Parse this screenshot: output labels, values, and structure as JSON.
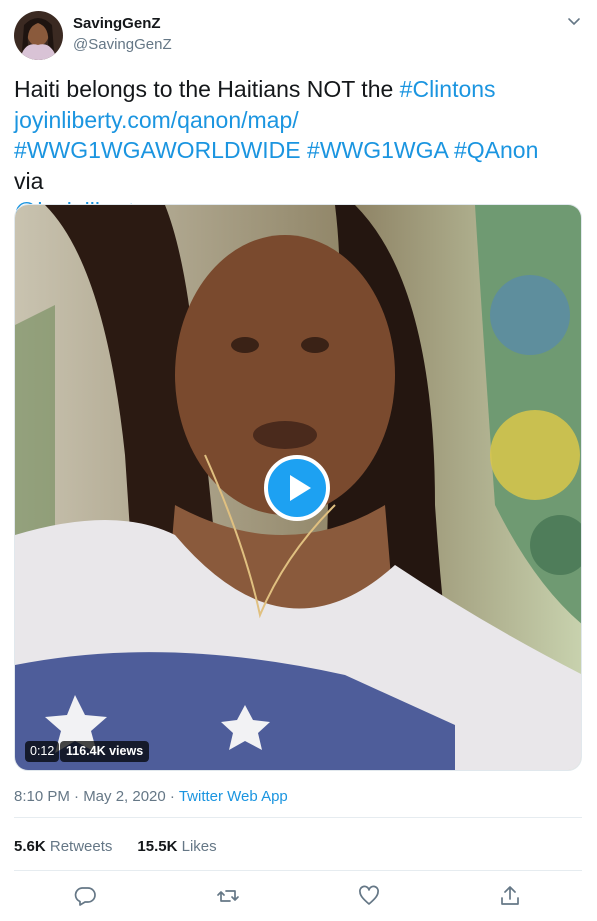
{
  "author": {
    "name": "SavingGenZ",
    "handle": "@SavingGenZ"
  },
  "tweet": {
    "text_plain_1": "Haiti belongs to the Haitians NOT the ",
    "hashtag_clintons": "#Clintons",
    "url": "joyinliberty.com/qanon/map/",
    "hashtag_1": "#WWG1WGAWORLDWIDE",
    "hashtag_2": "#WWG1WGA",
    "hashtag_3": "#QAnon",
    "via": " via",
    "mention": "@joyinliberty"
  },
  "video": {
    "duration": "0:12",
    "views": "116.4K views"
  },
  "meta": {
    "time": "8:10 PM · May 2, 2020 · ",
    "source": "Twitter Web App"
  },
  "stats": {
    "retweets_count": "5.6K",
    "retweets_label": "Retweets",
    "likes_count": "15.5K",
    "likes_label": "Likes"
  },
  "colors": {
    "link": "#1b95e0",
    "secondary": "#657786",
    "play": "#1da1f2"
  },
  "icons": [
    "chevron-down-icon",
    "play-icon",
    "reply-icon",
    "retweet-icon",
    "like-icon",
    "share-icon"
  ]
}
